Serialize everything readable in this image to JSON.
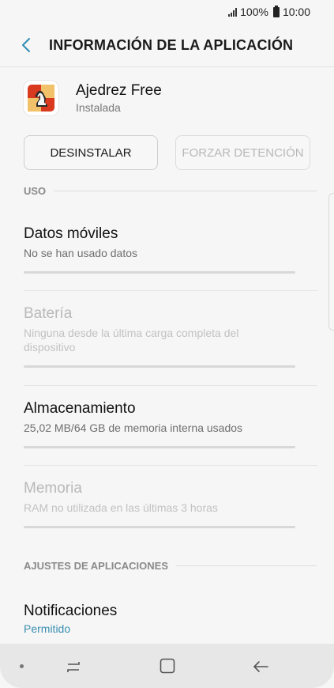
{
  "status_bar": {
    "battery_percent": "100%",
    "time": "10:00"
  },
  "header": {
    "title": "INFORMACIÓN DE LA APLICACIÓN",
    "back_icon": "chevron-left-icon"
  },
  "app": {
    "name": "Ajedrez Free",
    "status": "Instalada",
    "icon": "chess-app-icon"
  },
  "buttons": {
    "uninstall": "DESINSTALAR",
    "force_stop": "FORZAR DETENCIÓN"
  },
  "sections": {
    "usage": "USO",
    "app_settings": "AJUSTES DE APLICACIONES"
  },
  "usage_items": [
    {
      "title": "Datos móviles",
      "subtitle": "No se han usado datos",
      "enabled": true
    },
    {
      "title": "Batería",
      "subtitle": "Ninguna desde la última carga completa del dispositivo",
      "enabled": false
    },
    {
      "title": "Almacenamiento",
      "subtitle": "25,02 MB/64 GB de memoria interna usados",
      "enabled": true
    },
    {
      "title": "Memoria",
      "subtitle": "RAM no utilizada en las últimas 3 horas",
      "enabled": false
    }
  ],
  "settings_items": [
    {
      "title": "Notificaciones",
      "subtitle": "Permitido"
    }
  ],
  "colors": {
    "accent_link": "#3a8fb0",
    "back_arrow": "#2e8db3"
  }
}
